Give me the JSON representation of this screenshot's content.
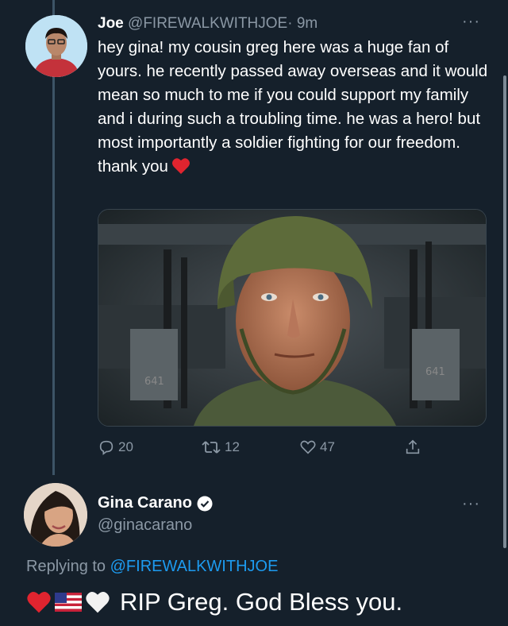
{
  "tweet": {
    "author_name": "Joe",
    "author_handle": "@FIREWALKWITHJOE",
    "time": "· 9m",
    "more": "···",
    "text": "hey gina! my cousin greg here was a huge fan of yours. he recently passed away overseas and it would mean so much to me if you could support my family and i during such a troubling time. he was a hero! but most importantly a soldier fighting for our freedom. thank you",
    "emoji": "red-heart",
    "photo": {
      "description_icon": "soldier-photo",
      "stencil_left": "641",
      "stencil_right": "641"
    },
    "actions": {
      "reply_count": "20",
      "retweet_count": "12",
      "like_count": "47"
    }
  },
  "reply": {
    "author_name": "Gina Carano",
    "verified": true,
    "author_handle": "@ginacarano",
    "more": "···",
    "replying_prefix": "Replying to ",
    "replying_to": "@FIREWALKWITHJOE",
    "emojis": [
      "red-heart",
      "us-flag",
      "white-heart"
    ],
    "text": "RIP Greg. God Bless you."
  },
  "colors": {
    "background": "#15202b",
    "secondary_text": "#8b98a5",
    "link": "#1d9bf0",
    "verified": "#ffffff"
  }
}
